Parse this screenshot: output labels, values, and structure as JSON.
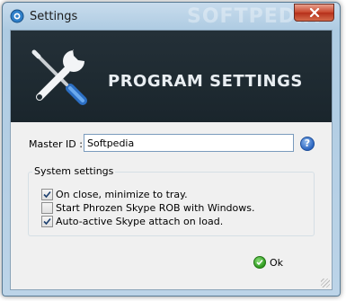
{
  "window": {
    "title": "Settings",
    "watermark": "SOFTPEDIA"
  },
  "header": {
    "heading": "PROGRAM SETTINGS",
    "icon": "wrench-screwdriver-icon"
  },
  "master": {
    "label": "Master ID :",
    "value": "Softpedia"
  },
  "system_settings": {
    "title": "System settings",
    "options": [
      {
        "label": "On close, minimize to tray.",
        "checked": true
      },
      {
        "label": "Start Phrozen Skype ROB with Windows.",
        "checked": false
      },
      {
        "label": "Auto-active Skype attach on load.",
        "checked": true
      }
    ]
  },
  "buttons": {
    "ok_label": "Ok",
    "help": "?"
  },
  "colors": {
    "header_bg": "#1e2a31",
    "accent_blue": "#2a64c0",
    "ok_green": "#2e9a1e",
    "close_red": "#c7452a"
  }
}
